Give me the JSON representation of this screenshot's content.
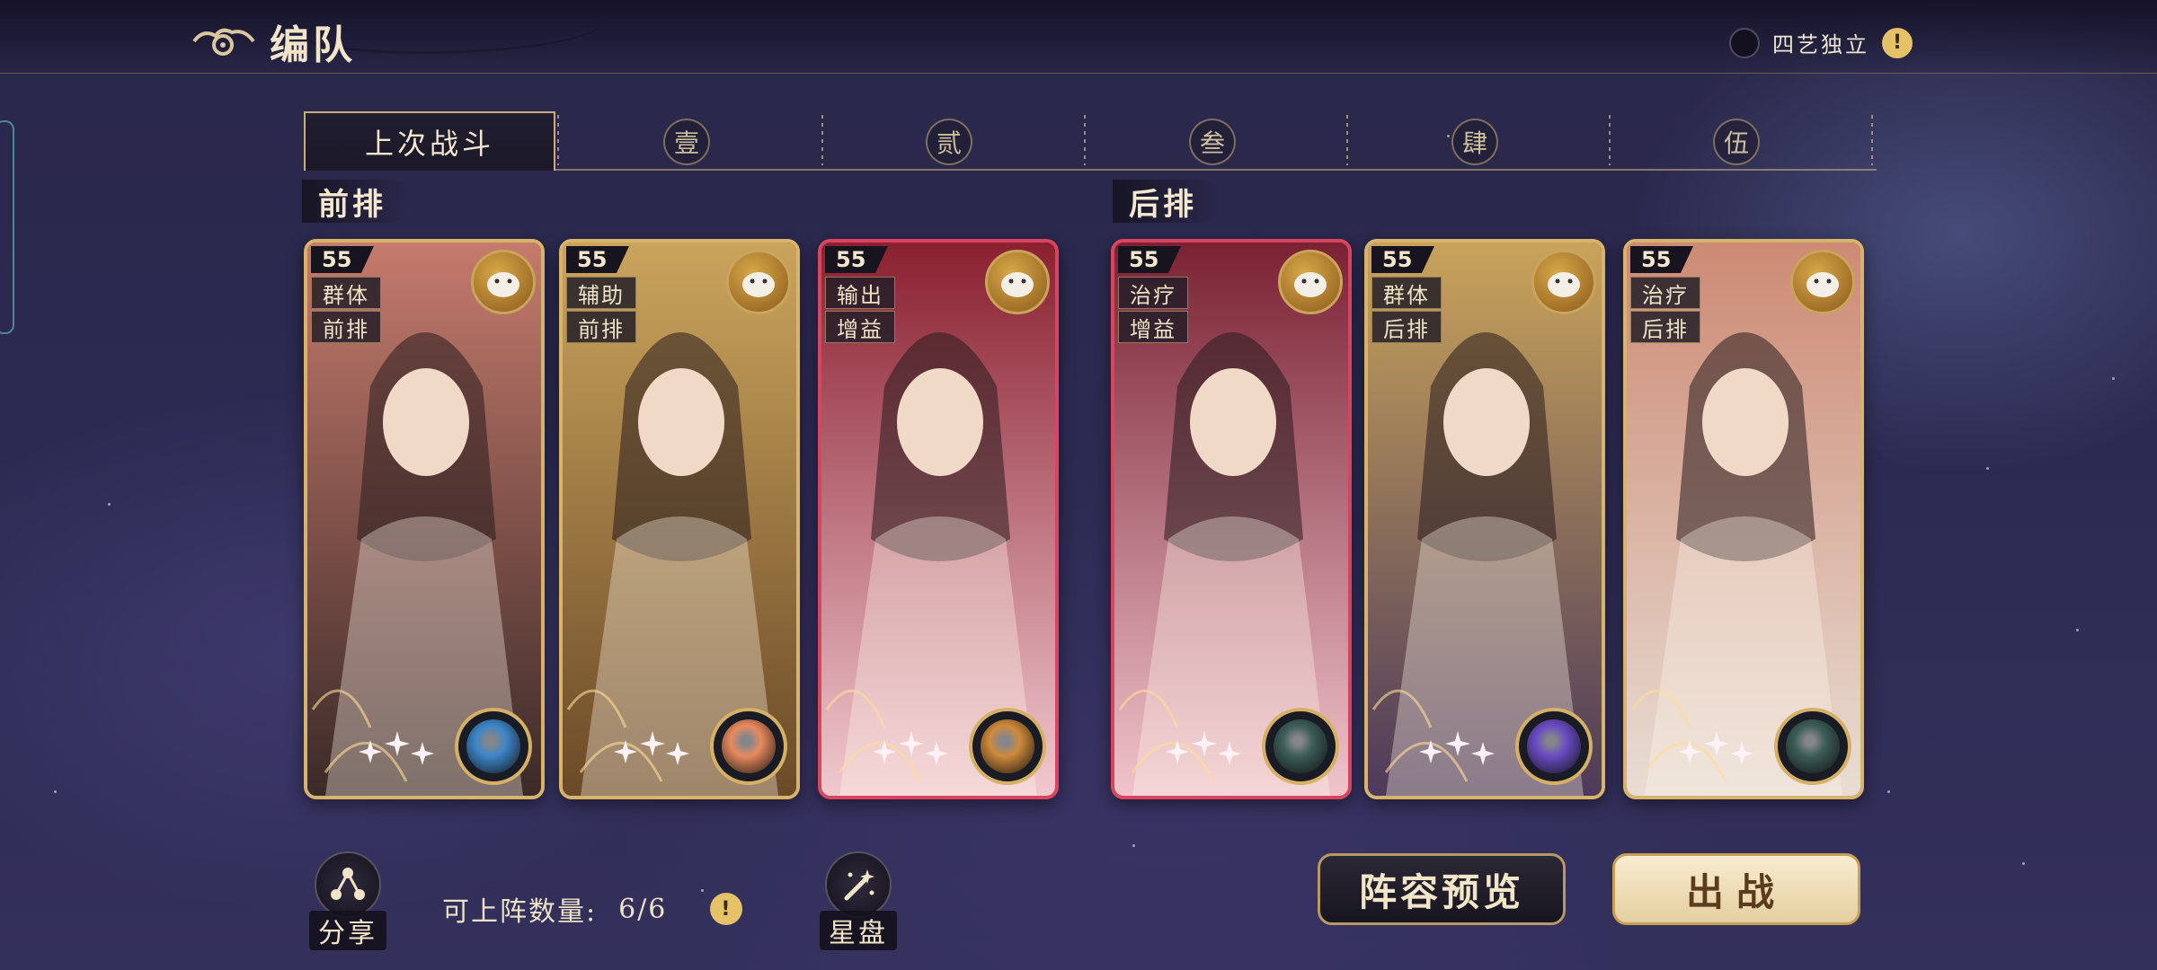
{
  "header": {
    "title": "编队",
    "toggle_label": "四艺独立",
    "info_icon_text": "!"
  },
  "tabs": {
    "active_label": "上次战斗",
    "numbers": [
      "壹",
      "贰",
      "叁",
      "肆",
      "伍"
    ]
  },
  "rows": {
    "front_label": "前排",
    "back_label": "后排"
  },
  "cards": [
    {
      "level": "55",
      "role1": "群体",
      "role2": "前排",
      "frame": "gold",
      "bg_colors": [
        "#c57a6c",
        "#3b2a28"
      ],
      "pet_icon": "wolf-pet-icon",
      "element_color": "#3d86c9"
    },
    {
      "level": "55",
      "role1": "辅助",
      "role2": "前排",
      "frame": "gold",
      "bg_colors": [
        "#caa45c",
        "#6b4a28"
      ],
      "pet_icon": "rabbit-pet-icon",
      "element_color": "#e88a5e"
    },
    {
      "level": "55",
      "role1": "输出",
      "role2": "增益",
      "frame": "red",
      "bg_colors": [
        "#8a2030",
        "#f1c9d0"
      ],
      "pet_icon": "blue-dragon-pet-icon",
      "element_color": "#d08a3a"
    },
    {
      "level": "55",
      "role1": "治疗",
      "role2": "增益",
      "frame": "red",
      "bg_colors": [
        "#7a2234",
        "#f0c4cc"
      ],
      "pet_icon": "sheep-pet-icon",
      "element_color": "#3c5d58"
    },
    {
      "level": "55",
      "role1": "群体",
      "role2": "后排",
      "frame": "gold",
      "bg_colors": [
        "#c9a35a",
        "#4d3a5a"
      ],
      "pet_icon": "monkey-pet-icon",
      "element_color": "#6a4cc4"
    },
    {
      "level": "55",
      "role1": "治疗",
      "role2": "后排",
      "frame": "gold",
      "bg_colors": [
        "#cd8a74",
        "#e8ddd4"
      ],
      "pet_icon": "fox-pet-icon",
      "element_color": "#3c5d58"
    }
  ],
  "footer": {
    "share_label": "分享",
    "capacity_label": "可上阵数量:",
    "capacity_value": "6/6",
    "star_chart_label": "星盘",
    "preview_label": "阵容预览",
    "battle_label": "出战"
  }
}
